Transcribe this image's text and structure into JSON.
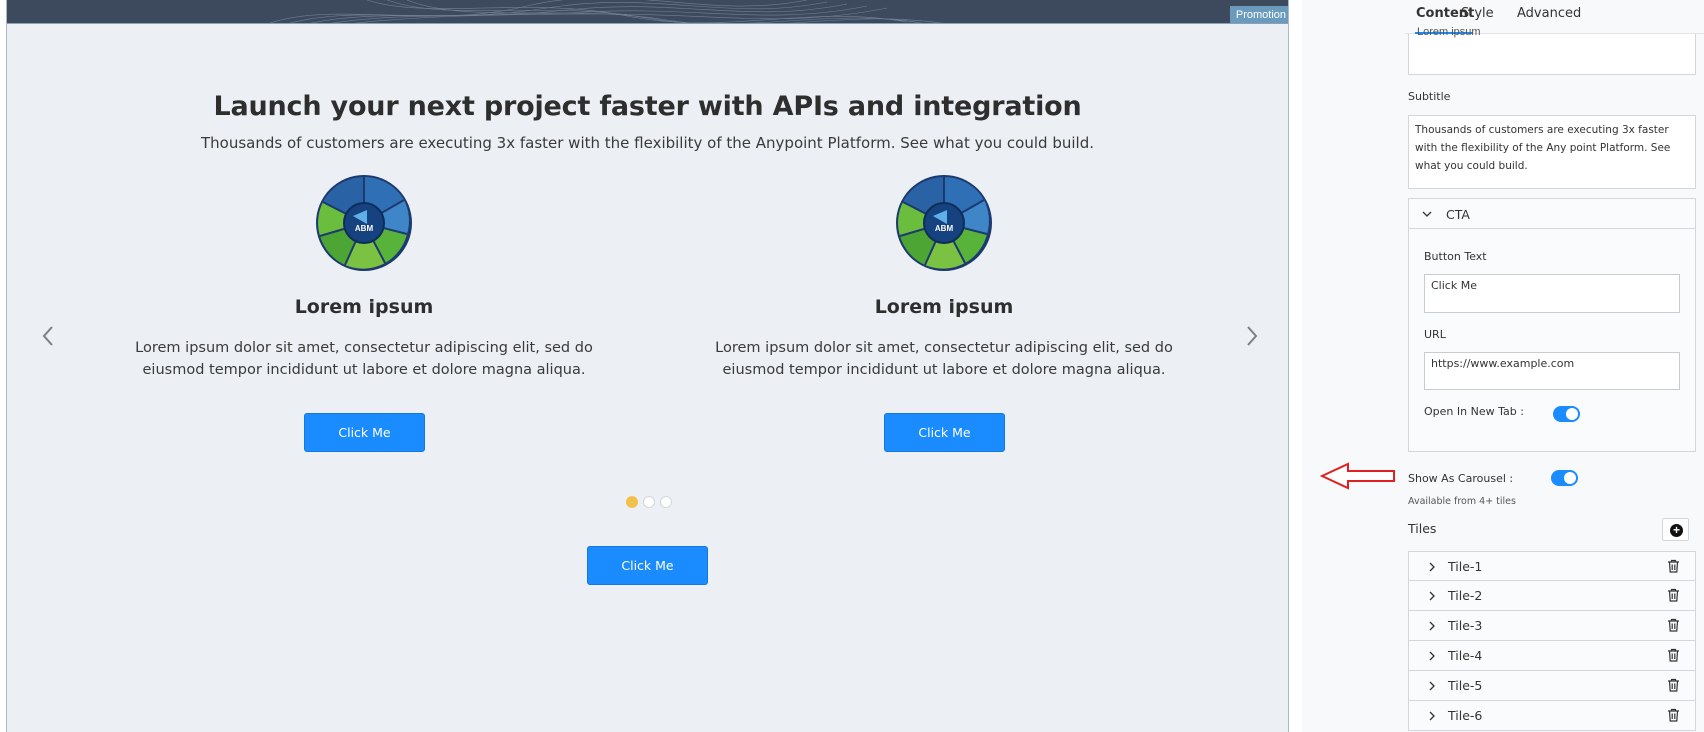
{
  "canvas": {
    "promo_tag": "Promotion",
    "hero_title": "Launch your next project faster with APIs and integration",
    "hero_subtitle": "Thousands of customers are executing 3x faster with the flexibility of the Anypoint Platform. See what you could build.",
    "tiles": [
      {
        "image_label": "ABM",
        "title": "Lorem ipsum",
        "text": "Lorem ipsum dolor sit amet, consectetur adipiscing elit, sed do eiusmod tempor incididunt ut labore et dolore magna aliqua.",
        "button": "Click Me"
      },
      {
        "image_label": "ABM",
        "title": "Lorem ipsum",
        "text": "Lorem ipsum dolor sit amet, consectetur adipiscing elit, sed do eiusmod tempor incididunt ut labore et dolore magna aliqua.",
        "button": "Click Me"
      }
    ],
    "carousel_dots": 3,
    "carousel_active_dot": 1,
    "main_cta": "Click Me",
    "colors": {
      "accent": "#1a8cff",
      "active_dot": "#f2c14a",
      "canvas_bg": "#eceff4"
    }
  },
  "panel": {
    "tabs": [
      {
        "label": "Content",
        "active": true
      },
      {
        "label": "Style",
        "active": false
      },
      {
        "label": "Advanced",
        "active": false
      }
    ],
    "title_field_partial": "Lorem ipsum",
    "subtitle_label": "Subtitle",
    "subtitle_value": "Thousands of customers are executing 3x faster with the flexibility of the Any point Platform. See what you could build.",
    "cta": {
      "header": "CTA",
      "button_text_label": "Button Text",
      "button_text_value": "Click Me",
      "url_label": "URL",
      "url_value": "https://www.example.com",
      "open_new_tab_label": "Open In New Tab :",
      "open_new_tab": true
    },
    "show_as_carousel_label": "Show As Carousel :",
    "show_as_carousel": true,
    "carousel_hint": "Available from 4+ tiles",
    "tiles_label": "Tiles",
    "tile_items": [
      "Tile-1",
      "Tile-2",
      "Tile-3",
      "Tile-4",
      "Tile-5",
      "Tile-6"
    ],
    "icons": {
      "add": "plus-circle-icon",
      "delete": "trash-icon",
      "expand": "chevron-right-icon",
      "collapse": "chevron-down-icon"
    }
  }
}
